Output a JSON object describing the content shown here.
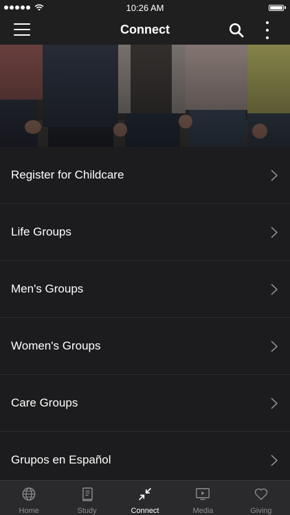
{
  "status_bar": {
    "time": "10:26 AM"
  },
  "nav": {
    "title": "Connect"
  },
  "list": {
    "items": [
      {
        "label": "Register for Childcare"
      },
      {
        "label": "Life Groups"
      },
      {
        "label": "Men's Groups"
      },
      {
        "label": "Women's Groups"
      },
      {
        "label": "Care Groups"
      },
      {
        "label": "Grupos en Español"
      }
    ]
  },
  "tabs": [
    {
      "label": "Home",
      "icon": "globe-icon"
    },
    {
      "label": "Study",
      "icon": "book-icon"
    },
    {
      "label": "Connect",
      "icon": "connect-arrows-icon",
      "active": true
    },
    {
      "label": "Media",
      "icon": "play-screen-icon"
    },
    {
      "label": "Giving",
      "icon": "heart-icon"
    }
  ],
  "colors": {
    "background": "#1c1c1e",
    "bar": "#1f1f20",
    "tab_inactive": "#8e8e93",
    "tab_active": "#ffffff"
  }
}
